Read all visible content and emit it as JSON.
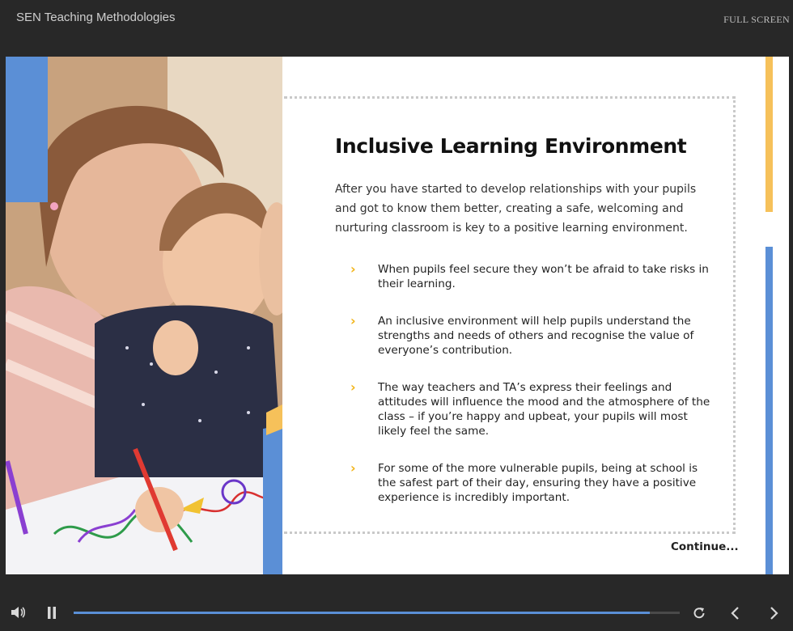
{
  "header": {
    "title": "SEN Teaching Methodologies",
    "fullscreen_label": "FULL SCREEN"
  },
  "slide": {
    "heading": "Inclusive Learning Environment",
    "intro": "After you have started to develop relationships with your pupils and got to know them better, creating a safe, welcoming and nurturing classroom is key to a positive learning environment.",
    "bullets": [
      "When pupils feel secure they won’t be afraid to take risks in their learning.",
      "An inclusive environment will help pupils understand the strengths and needs of others and recognise the value of everyone’s contribution.",
      "The way teachers and TA’s express their feelings and attitudes will influence the mood and the atmosphere of the class – if you’re happy and upbeat, your pupils will most likely feel the same.",
      "For some of the more vulnerable pupils, being at school is the safest part of their day, ensuring they have a positive experience is incredibly important."
    ],
    "bullet_icon": "chevron-right-icon",
    "continue_label": "Continue..."
  },
  "player": {
    "progress": 0.95,
    "icons": [
      "volume-icon",
      "pause-icon",
      "replay-icon",
      "previous-icon",
      "next-icon"
    ]
  },
  "colors": {
    "accent_blue": "#5b8fd6",
    "accent_yellow": "#f6c15a",
    "chevron": "#f2b418",
    "chrome": "#282828"
  }
}
